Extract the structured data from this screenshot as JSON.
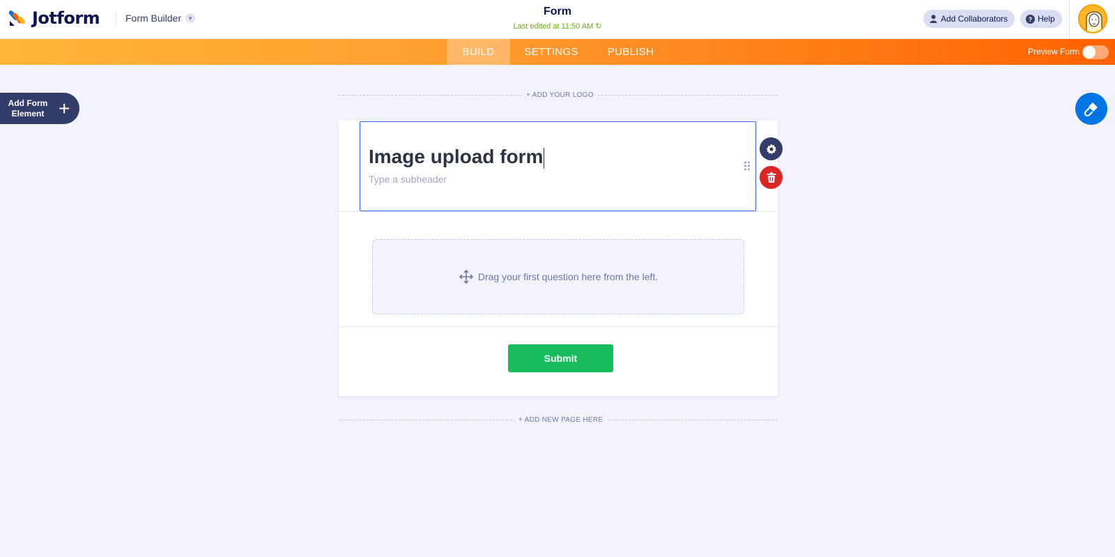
{
  "brand": {
    "name": "Jotform"
  },
  "header": {
    "builder_label": "Form Builder",
    "form_title": "Form",
    "last_edited": "Last edited at 11:50 AM",
    "collaborators_label": "Add Collaborators",
    "help_label": "Help"
  },
  "nav": {
    "tabs": [
      {
        "label": "BUILD",
        "active": true
      },
      {
        "label": "SETTINGS",
        "active": false
      },
      {
        "label": "PUBLISH",
        "active": false
      }
    ],
    "preview_label": "Preview Form",
    "preview_on": false
  },
  "sidebar": {
    "add_element_label_1": "Add Form",
    "add_element_label_2": "Element"
  },
  "canvas": {
    "add_logo_label": "+ ADD YOUR LOGO",
    "heading": "Image upload form",
    "subheader_placeholder": "Type a subheader",
    "drop_hint": "Drag your first question here from the left.",
    "submit_label": "Submit",
    "add_page_label": "+ ADD NEW PAGE HERE"
  },
  "colors": {
    "accent_blue": "#0075e3",
    "submit_green": "#18bd5b",
    "delete_red": "#dc2626",
    "nav_orange": "#ff6100",
    "navy": "#343c6a"
  }
}
